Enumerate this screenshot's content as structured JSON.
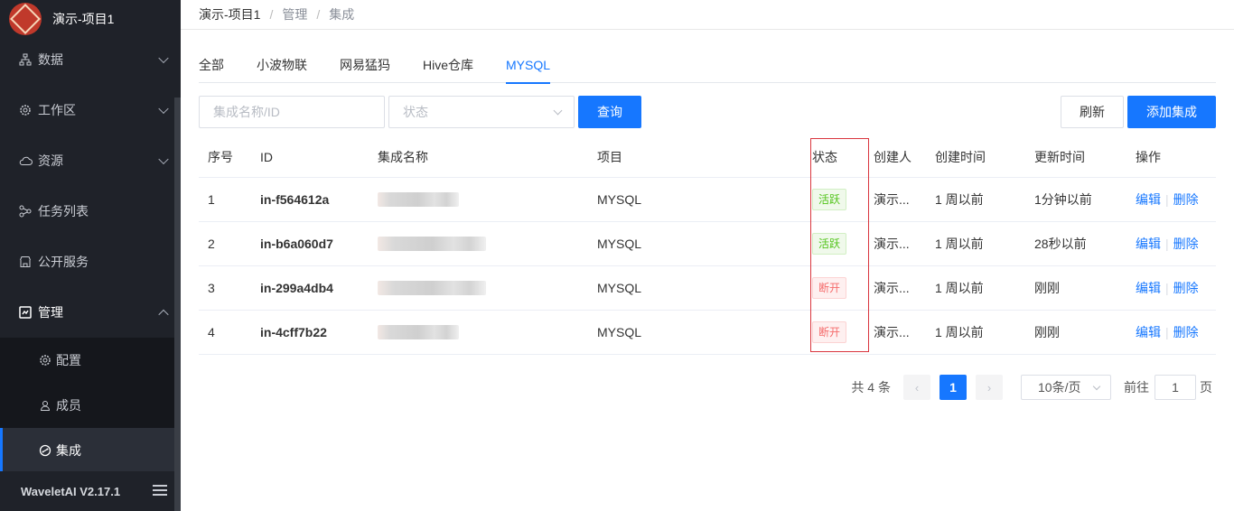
{
  "app": {
    "title": "演示-项目1",
    "version": "WaveletAI V2.17.1"
  },
  "sidebar": {
    "items": [
      {
        "label": "数据",
        "icon": "sitemap-icon",
        "expanded": false
      },
      {
        "label": "工作区",
        "icon": "gear-icon",
        "expanded": false
      },
      {
        "label": "资源",
        "icon": "cloud-icon",
        "expanded": false
      },
      {
        "label": "任务列表",
        "icon": "share-icon",
        "expanded": null
      },
      {
        "label": "公开服务",
        "icon": "shop-icon",
        "expanded": null
      },
      {
        "label": "管理",
        "icon": "chart-icon",
        "expanded": true
      }
    ],
    "subitems": [
      {
        "label": "配置",
        "icon": "gear-icon"
      },
      {
        "label": "成员",
        "icon": "user-icon"
      },
      {
        "label": "集成",
        "icon": "link-icon",
        "active": true
      }
    ]
  },
  "breadcrumb": [
    "演示-项目1",
    "管理",
    "集成"
  ],
  "tabs": [
    {
      "label": "全部"
    },
    {
      "label": "小波物联"
    },
    {
      "label": "网易猛犸"
    },
    {
      "label": "Hive仓库"
    },
    {
      "label": "MYSQL",
      "active": true
    }
  ],
  "filters": {
    "name_placeholder": "集成名称/ID",
    "status_placeholder": "状态",
    "query_label": "查询",
    "refresh_label": "刷新",
    "add_label": "添加集成"
  },
  "table": {
    "columns": [
      "序号",
      "ID",
      "集成名称",
      "项目",
      "状态",
      "创建人",
      "创建时间",
      "更新时间",
      "操作"
    ],
    "rows": [
      {
        "index": "1",
        "id": "in-f564612a",
        "project": "MYSQL",
        "status": "活跃",
        "status_type": "on",
        "creator": "演示...",
        "created": "1 周以前",
        "updated": "1分钟以前",
        "edit": "编辑",
        "delete": "删除"
      },
      {
        "index": "2",
        "id": "in-b6a060d7",
        "project": "MYSQL",
        "status": "活跃",
        "status_type": "on",
        "creator": "演示...",
        "created": "1 周以前",
        "updated": "28秒以前",
        "edit": "编辑",
        "delete": "删除"
      },
      {
        "index": "3",
        "id": "in-299a4db4",
        "project": "MYSQL",
        "status": "断开",
        "status_type": "off",
        "creator": "演示...",
        "created": "1 周以前",
        "updated": "刚刚",
        "edit": "编辑",
        "delete": "删除"
      },
      {
        "index": "4",
        "id": "in-4cff7b22",
        "project": "MYSQL",
        "status": "断开",
        "status_type": "off",
        "creator": "演示...",
        "created": "1 周以前",
        "updated": "刚刚",
        "edit": "编辑",
        "delete": "删除"
      }
    ]
  },
  "pagination": {
    "total": "共 4 条",
    "current": "1",
    "page_size": "10条/页",
    "goto_label": "前往",
    "goto_value": "1",
    "page_suffix": "页"
  }
}
